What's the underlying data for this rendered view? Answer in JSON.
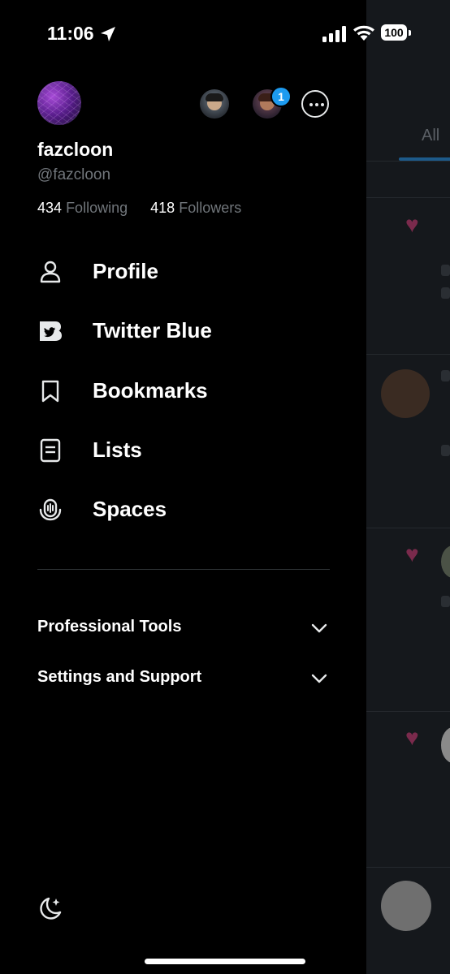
{
  "status_bar": {
    "time": "11:06",
    "battery": "100"
  },
  "account_switcher": {
    "notification_count": "1"
  },
  "profile": {
    "display_name": "fazcloon",
    "handle": "@fazcloon",
    "following_count": "434",
    "following_label": "Following",
    "followers_count": "418",
    "followers_label": "Followers"
  },
  "menu": {
    "items": [
      {
        "label": "Profile",
        "icon": "person-icon"
      },
      {
        "label": "Twitter Blue",
        "icon": "twitter-blue-icon"
      },
      {
        "label": "Bookmarks",
        "icon": "bookmark-icon"
      },
      {
        "label": "Lists",
        "icon": "lists-icon"
      },
      {
        "label": "Spaces",
        "icon": "spaces-icon"
      }
    ]
  },
  "sections": [
    {
      "label": "Professional Tools"
    },
    {
      "label": "Settings and Support"
    }
  ],
  "background": {
    "tab_label": "All"
  },
  "colors": {
    "background": "#000000",
    "text": "#e7e9ea",
    "secondary_text": "#71767b",
    "accent": "#1d9bf0"
  }
}
